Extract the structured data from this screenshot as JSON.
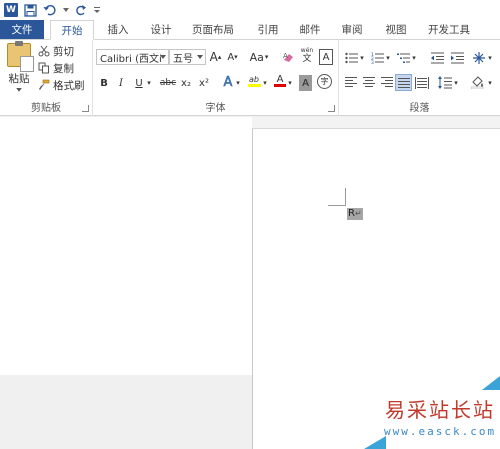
{
  "app": {
    "logo_letter": "W"
  },
  "tabs": [
    {
      "label": "文件"
    },
    {
      "label": "开始"
    },
    {
      "label": "插入"
    },
    {
      "label": "设计"
    },
    {
      "label": "页面布局"
    },
    {
      "label": "引用"
    },
    {
      "label": "邮件"
    },
    {
      "label": "审阅"
    },
    {
      "label": "视图"
    },
    {
      "label": "开发工具"
    }
  ],
  "clipboard": {
    "paste": "粘贴",
    "cut": "剪切",
    "copy": "复制",
    "format_painter": "格式刷",
    "group_label": "剪贴板"
  },
  "font": {
    "family": "Calibri (西文i",
    "size": "五号",
    "grow": "A",
    "shrink": "A",
    "case": "Aa",
    "phonetic": "wén",
    "phonetic_sub": "文",
    "border_char": "A",
    "bold": "B",
    "italic": "I",
    "underline": "U",
    "strike": "abc",
    "subscript": "x₂",
    "superscript": "x²",
    "effects": "A",
    "highlight": "ab",
    "color": "A",
    "shading": "A",
    "enclose": "字",
    "group_label": "字体"
  },
  "paragraph": {
    "group_label": "段落"
  },
  "document": {
    "text": "R",
    "mark": "↵"
  },
  "watermark": {
    "text": "易采站长站",
    "url": "www.easck.com"
  },
  "colors": {
    "accent": "#2b579a",
    "highlight": "#ffff00",
    "font_color": "#e00000"
  }
}
